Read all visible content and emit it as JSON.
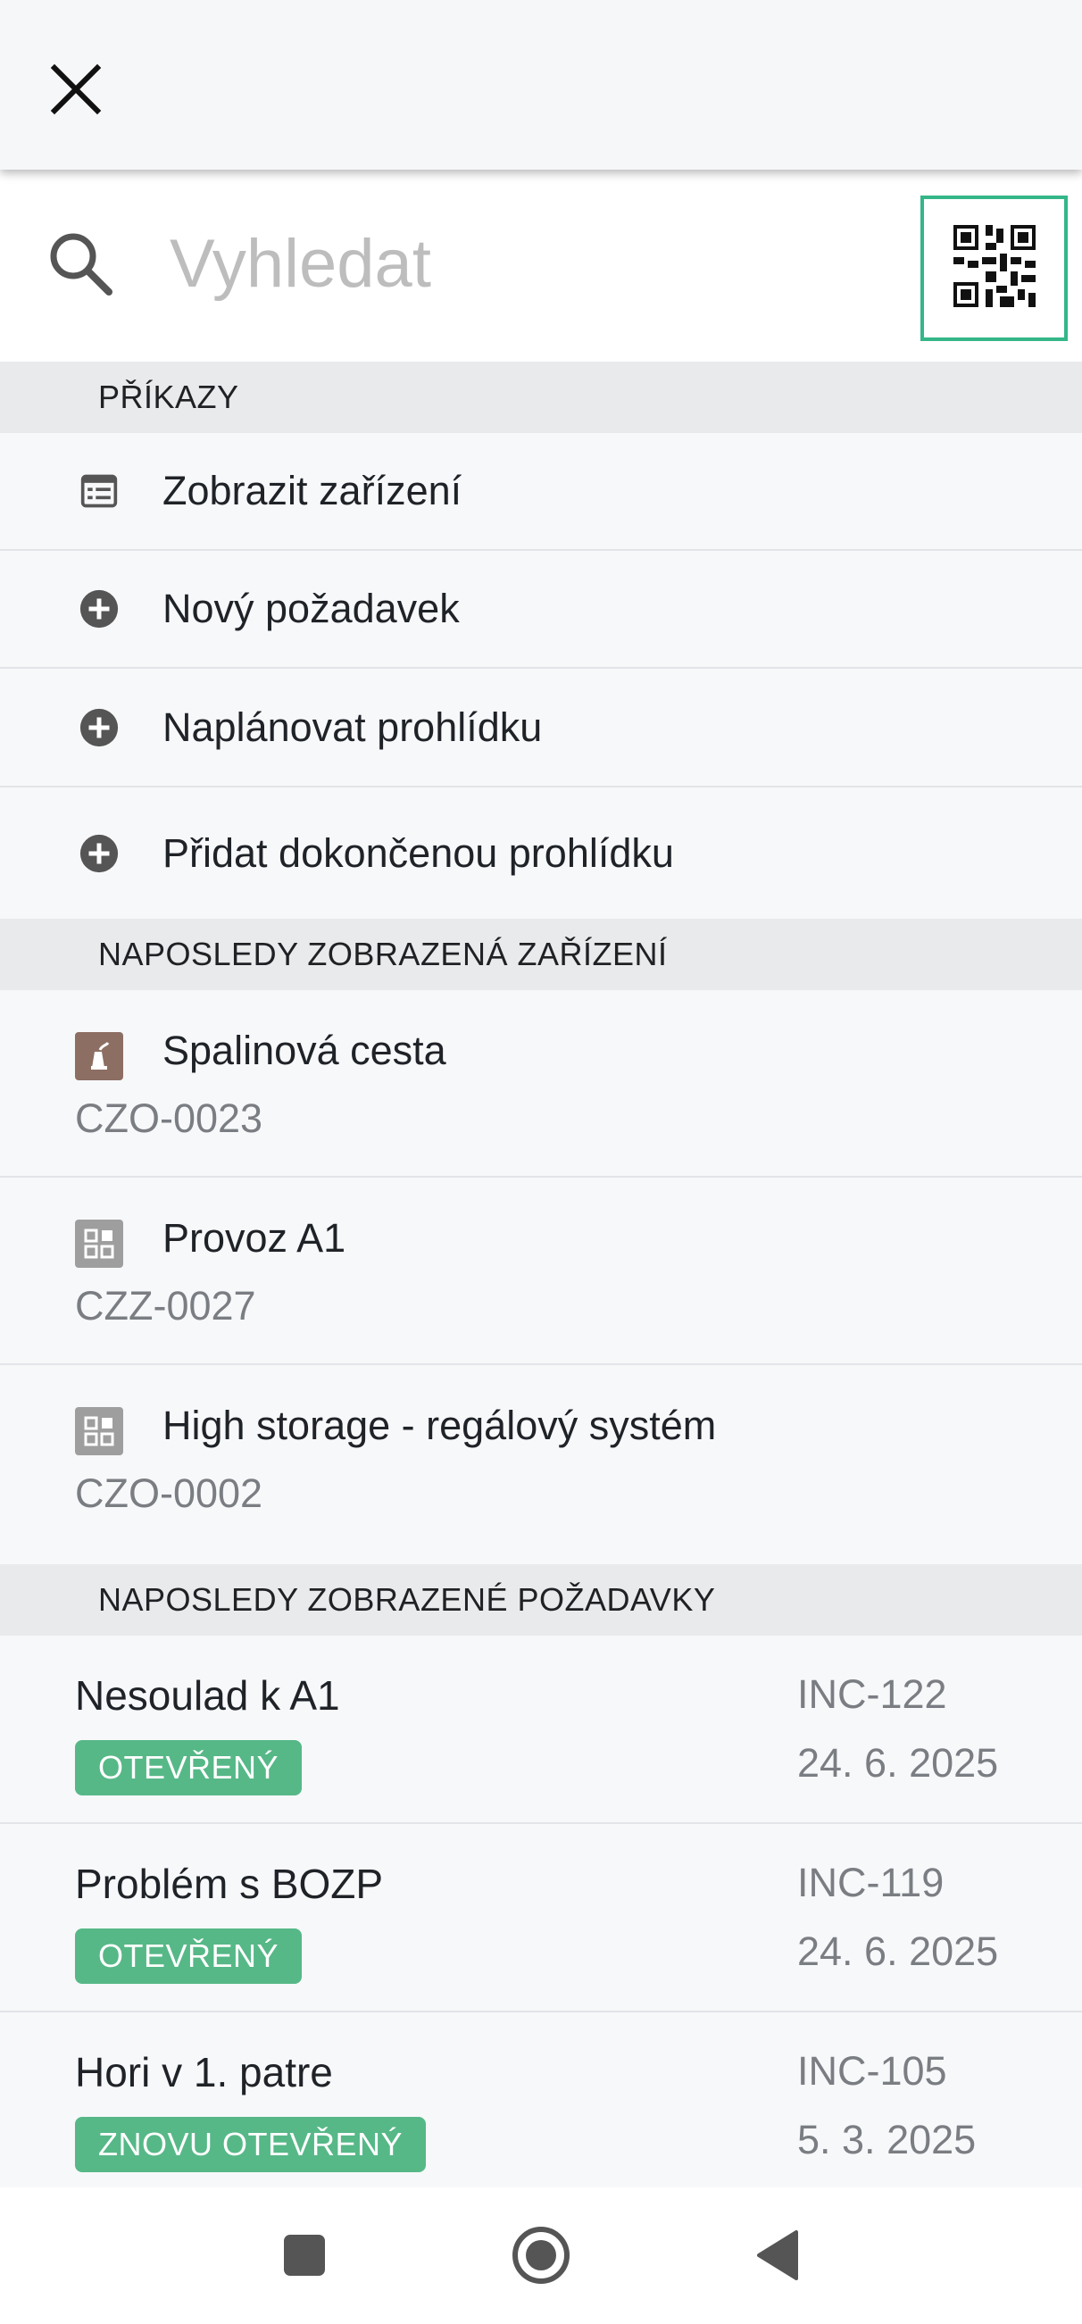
{
  "header": {
    "close_icon": "close-icon"
  },
  "search": {
    "placeholder": "Vyhledat",
    "value": "",
    "search_icon": "search-icon",
    "qr_icon": "qr-code-icon",
    "qr_border_color": "#35b688"
  },
  "commands": {
    "title": "PŘÍKAZY",
    "items": [
      {
        "label": "Zobrazit zařízení",
        "icon": "list-icon"
      },
      {
        "label": "Nový požadavek",
        "icon": "add-circle-icon"
      },
      {
        "label": "Naplánovat prohlídku",
        "icon": "add-circle-icon"
      },
      {
        "label": "Přidat dokončenou prohlídku",
        "icon": "add-circle-icon"
      }
    ]
  },
  "recent_assets": {
    "title": "NAPOSLEDY ZOBRAZENÁ ZAŘÍZENÍ",
    "items": [
      {
        "name": "Spalinová cesta",
        "code": "CZO-0023",
        "icon": "chimney-icon",
        "icon_color": "#8d6e63"
      },
      {
        "name": "Provoz A1",
        "code": "CZZ-0027",
        "icon": "grid-asset-icon",
        "icon_color": "#9e9e9e"
      },
      {
        "name": "High storage - regálový systém",
        "code": "CZO-0002",
        "icon": "grid-asset-icon",
        "icon_color": "#9e9e9e"
      }
    ]
  },
  "recent_requests": {
    "title": "NAPOSLEDY ZOBRAZENÉ POŽADAVKY",
    "items": [
      {
        "title": "Nesoulad k A1",
        "status": "OTEVŘENÝ",
        "code": "INC-122",
        "date": "24. 6. 2025"
      },
      {
        "title": "Problém s BOZP",
        "status": "OTEVŘENÝ",
        "code": "INC-119",
        "date": "24. 6. 2025"
      },
      {
        "title": "Hori v 1. patre",
        "status": "ZNOVU OTEVŘENÝ",
        "code": "INC-105",
        "date": "5. 3. 2025"
      }
    ],
    "status_color": "#56b887"
  },
  "system_nav": {
    "recents": "square-icon",
    "home": "circle-icon",
    "back": "triangle-back-icon"
  }
}
